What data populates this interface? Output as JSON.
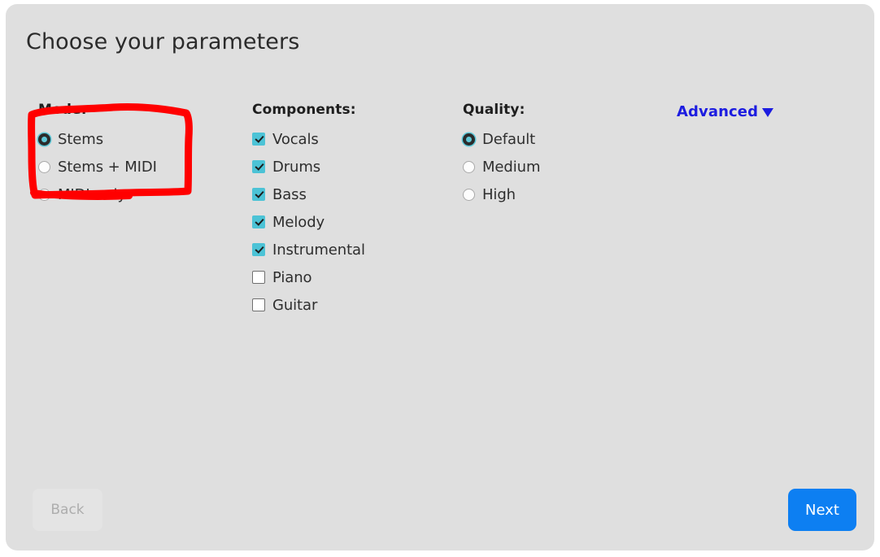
{
  "page": {
    "title": "Choose your parameters",
    "card_background": "#dfdfdf",
    "outer_background": "#ffffff"
  },
  "groups": {
    "mode": {
      "title": "Mode:",
      "type": "radio",
      "selected": "Stems",
      "options": [
        {
          "label": "Stems",
          "checked": true
        },
        {
          "label": "Stems + MIDI",
          "checked": false
        },
        {
          "label": "MIDI-only",
          "checked": false
        }
      ]
    },
    "components": {
      "title": "Components:",
      "type": "checkbox",
      "options": [
        {
          "label": "Vocals",
          "checked": true
        },
        {
          "label": "Drums",
          "checked": true
        },
        {
          "label": "Bass",
          "checked": true
        },
        {
          "label": "Melody",
          "checked": true
        },
        {
          "label": "Instrumental",
          "checked": true
        },
        {
          "label": "Piano",
          "checked": false
        },
        {
          "label": "Guitar",
          "checked": false
        }
      ]
    },
    "quality": {
      "title": "Quality:",
      "type": "radio",
      "selected": "Default",
      "options": [
        {
          "label": "Default",
          "checked": true
        },
        {
          "label": "Medium",
          "checked": false
        },
        {
          "label": "High",
          "checked": false
        }
      ]
    }
  },
  "advanced": {
    "label": "Advanced",
    "caret_icon": "chevron-down-icon",
    "color": "#1c1ce0",
    "expanded": false
  },
  "footer": {
    "back_label": "Back",
    "back_disabled": true,
    "next_label": "Next",
    "next_color": "#0d7ff2"
  },
  "annotation": {
    "shape": "hand-drawn-rectangle",
    "color": "#ff0000",
    "target": "mode-group"
  },
  "colors": {
    "accent_teal": "#4cc3d6",
    "primary_blue": "#0d7ff2",
    "link_blue": "#1c1ce0",
    "annotation_red": "#ff0000",
    "text_dark": "#2b2b2b"
  }
}
